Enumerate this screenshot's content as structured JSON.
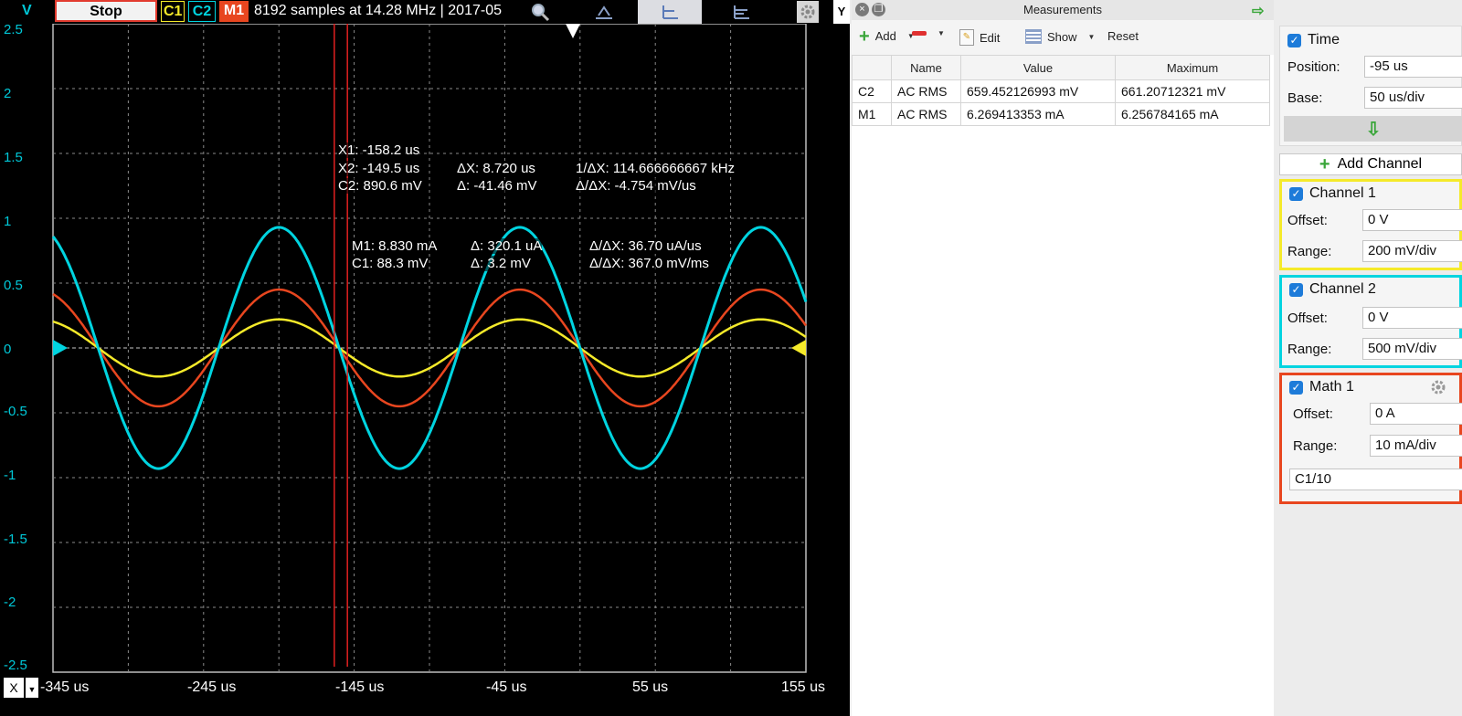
{
  "toolbar": {
    "y_unit": "V",
    "stop_label": "Stop",
    "chips": [
      "C1",
      "C2",
      "M1"
    ],
    "samples_text": "8192 samples at 14.28 MHz | 2017-05",
    "yaxis_tab": "Y"
  },
  "plot": {
    "y_ticks": [
      "2.5",
      "2",
      "1.5",
      "1",
      "0.5",
      "0",
      "-0.5",
      "-1",
      "-1.5",
      "-2",
      "-2.5"
    ],
    "x_ticks": [
      "-345 us",
      "-245 us",
      "-145 us",
      "-45 us",
      "55 us",
      "155 us"
    ],
    "x_axis_label": "X",
    "colors": {
      "c1": "#f5ea2a",
      "c2": "#00d4e0",
      "m1": "#e8461f",
      "cursor": "#e02020",
      "grid": "#8a8a8a"
    },
    "annotations": {
      "x1": "X1: -158.2 us",
      "x2": "X2: -149.5 us",
      "dx": "ΔX: 8.720 us",
      "inv_dx": "1/ΔX: 114.666666667 kHz",
      "c2": "C2: 890.6 mV",
      "c2_delta": "Δ: -41.46 mV",
      "c2_rate": "Δ/ΔX: -4.754 mV/us",
      "m1": "M1: 8.830 mA",
      "m1_delta": "Δ: 320.1 uA",
      "m1_rate": "Δ/ΔX: 36.70 uA/us",
      "c1": "C1: 88.3 mV",
      "c1_delta": "Δ: 3.2 mV",
      "c1_rate": "Δ/ΔX: 367.0 mV/ms"
    }
  },
  "chart_data": {
    "type": "line",
    "x_unit": "us",
    "xlim": [
      -345,
      155
    ],
    "ylim": [
      -2.5,
      2.5
    ],
    "ylabel": "V",
    "grid": true,
    "cursors_x": [
      -158.2,
      -149.5
    ],
    "period_us": 160,
    "series": [
      {
        "name": "C1",
        "amplitude": 0.22,
        "phase_zero_us": -315
      },
      {
        "name": "C2",
        "amplitude": 0.93,
        "phase_zero_us": -315
      },
      {
        "name": "M1",
        "amplitude": 0.45,
        "phase_zero_us": -315
      }
    ]
  },
  "measurements": {
    "title": "Measurements",
    "toolbar": {
      "add": "Add",
      "edit": "Edit",
      "show": "Show",
      "reset": "Reset"
    },
    "columns": [
      "",
      "Name",
      "Value",
      "Maximum"
    ],
    "rows": [
      [
        "C2",
        "AC RMS",
        "659.452126993 mV",
        "661.20712321 mV"
      ],
      [
        "M1",
        "AC RMS",
        "6.269413353 mA",
        "6.256784165 mA"
      ]
    ]
  },
  "side": {
    "time": {
      "title": "Time",
      "position_label": "Position:",
      "position": "-95 us",
      "base_label": "Base:",
      "base": "50 us/div"
    },
    "add_channel": "Add Channel",
    "channel1": {
      "title": "Channel 1",
      "offset_label": "Offset:",
      "offset": "0 V",
      "range_label": "Range:",
      "range": "200 mV/div",
      "color": "#f5ea2a"
    },
    "channel2": {
      "title": "Channel 2",
      "offset_label": "Offset:",
      "offset": "0 V",
      "range_label": "Range:",
      "range": "500 mV/div",
      "color": "#00d4e0"
    },
    "math1": {
      "title": "Math 1",
      "offset_label": "Offset:",
      "offset": "0 A",
      "range_label": "Range:",
      "range": "10 mA/div",
      "expression": "C1/10",
      "color": "#e8461f"
    }
  }
}
